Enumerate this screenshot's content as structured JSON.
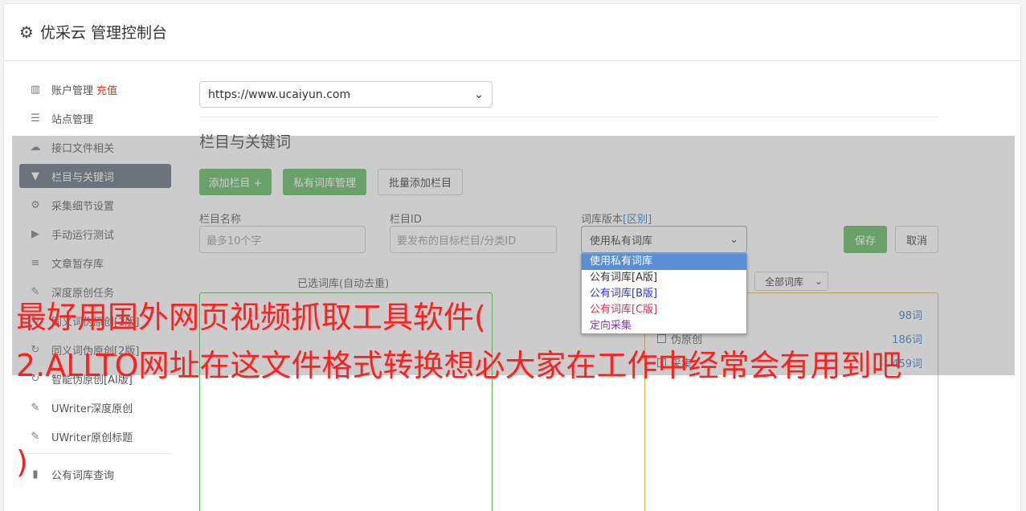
{
  "header": {
    "title": "优采云 管理控制台"
  },
  "sidebar": {
    "items": [
      {
        "label": "账户管理",
        "badge": "充值",
        "icon": "bar-chart-icon"
      },
      {
        "label": "站点管理",
        "icon": "server-icon"
      },
      {
        "label": "接口文件相关",
        "icon": "cloud-upload-icon"
      },
      {
        "label": "栏目与关键词",
        "icon": "filter-icon",
        "active": true
      },
      {
        "label": "采集细节设置",
        "icon": "cogs-icon"
      },
      {
        "label": "手动运行测试",
        "icon": "play-circle-icon"
      },
      {
        "label": "文章暂存库",
        "icon": "database-icon"
      },
      {
        "label": "深度原创任务",
        "icon": "edit-icon"
      },
      {
        "label": "同义词伪原创[1版]",
        "icon": "refresh-icon"
      },
      {
        "label": "同义词伪原创[2版]",
        "icon": "refresh-icon"
      },
      {
        "label": "智能伪原创[AI版]",
        "icon": "refresh-icon"
      },
      {
        "label": "UWriter深度原创",
        "icon": "edit-icon"
      },
      {
        "label": "UWriter原创标题",
        "icon": "edit-icon"
      },
      {
        "label": "公有词库查询",
        "icon": "book-icon"
      }
    ]
  },
  "main": {
    "site_select": "https://www.ucaiyun.com",
    "section_title": "栏目与关键词",
    "buttons": {
      "add_column": "添加栏目 +",
      "private_lib": "私有词库管理",
      "batch_add": "批量添加栏目",
      "save": "保存",
      "cancel": "取消"
    },
    "fields": {
      "column_name_label": "栏目名称",
      "column_name_placeholder": "最多10个字",
      "column_id_label": "栏目ID",
      "column_id_placeholder": "要发布的目标栏目/分类ID",
      "lib_version_label": "词库版本",
      "lib_version_link": "[区别]",
      "lib_version_value": "使用私有词库"
    },
    "dropdown_options": [
      "使用私有词库",
      "公有词库[A版]",
      "公有词库[B版]",
      "公有词库[C版]",
      "定向采集"
    ],
    "selected_libs_title": "已选词库(自动去重)",
    "lib_filter": "全部词库",
    "libraries": [
      {
        "name": "",
        "count": "98词"
      },
      {
        "name": "伪原创",
        "count": "186词"
      },
      {
        "name": "采集",
        "count": "459词"
      }
    ]
  },
  "caption": {
    "line1": "最好用国外网页视频抓取工具软件(",
    "line2": "2.ALLTO网址在这文件格式转换想必大家在工作中经常会有用到吧",
    "line3": ")"
  }
}
